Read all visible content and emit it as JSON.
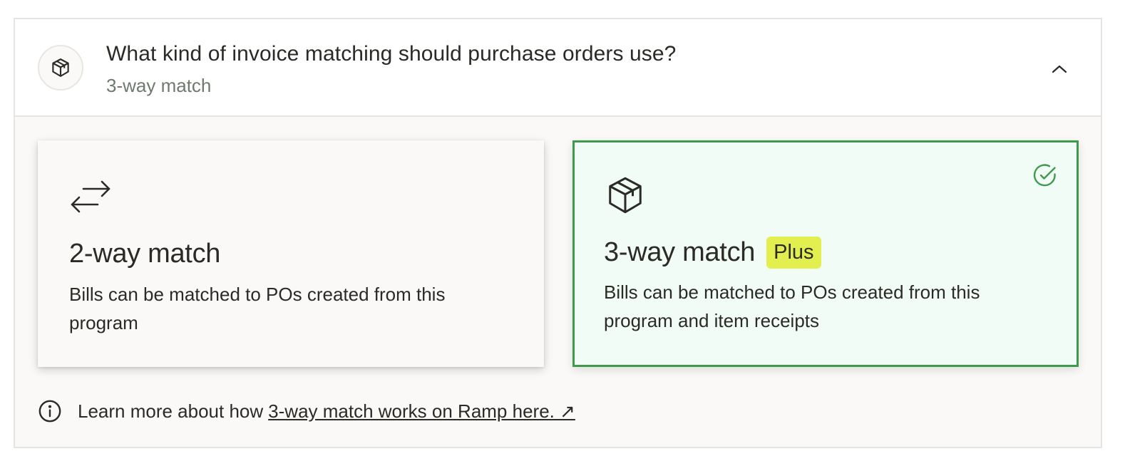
{
  "header": {
    "icon": "package-icon",
    "title": "What kind of invoice matching should purchase orders use?",
    "subtitle": "3-way match",
    "collapse_icon": "chevron-up-icon"
  },
  "options": [
    {
      "icon": "arrows-left-right-icon",
      "title": "2-way match",
      "description": "Bills can be matched to POs created from this program",
      "selected": false
    },
    {
      "icon": "package-icon",
      "title": "3-way match",
      "badge": "Plus",
      "description": "Bills can be matched to POs created from this program and item receipts",
      "selected": true
    }
  ],
  "footer": {
    "icon": "info-icon",
    "text": "Learn more about how",
    "link": "3-way match works on Ramp here. ↗"
  },
  "colors": {
    "selected_border": "#3f9a4e",
    "selected_bg": "#f2fcf6",
    "badge_bg": "#e3ef4f"
  }
}
